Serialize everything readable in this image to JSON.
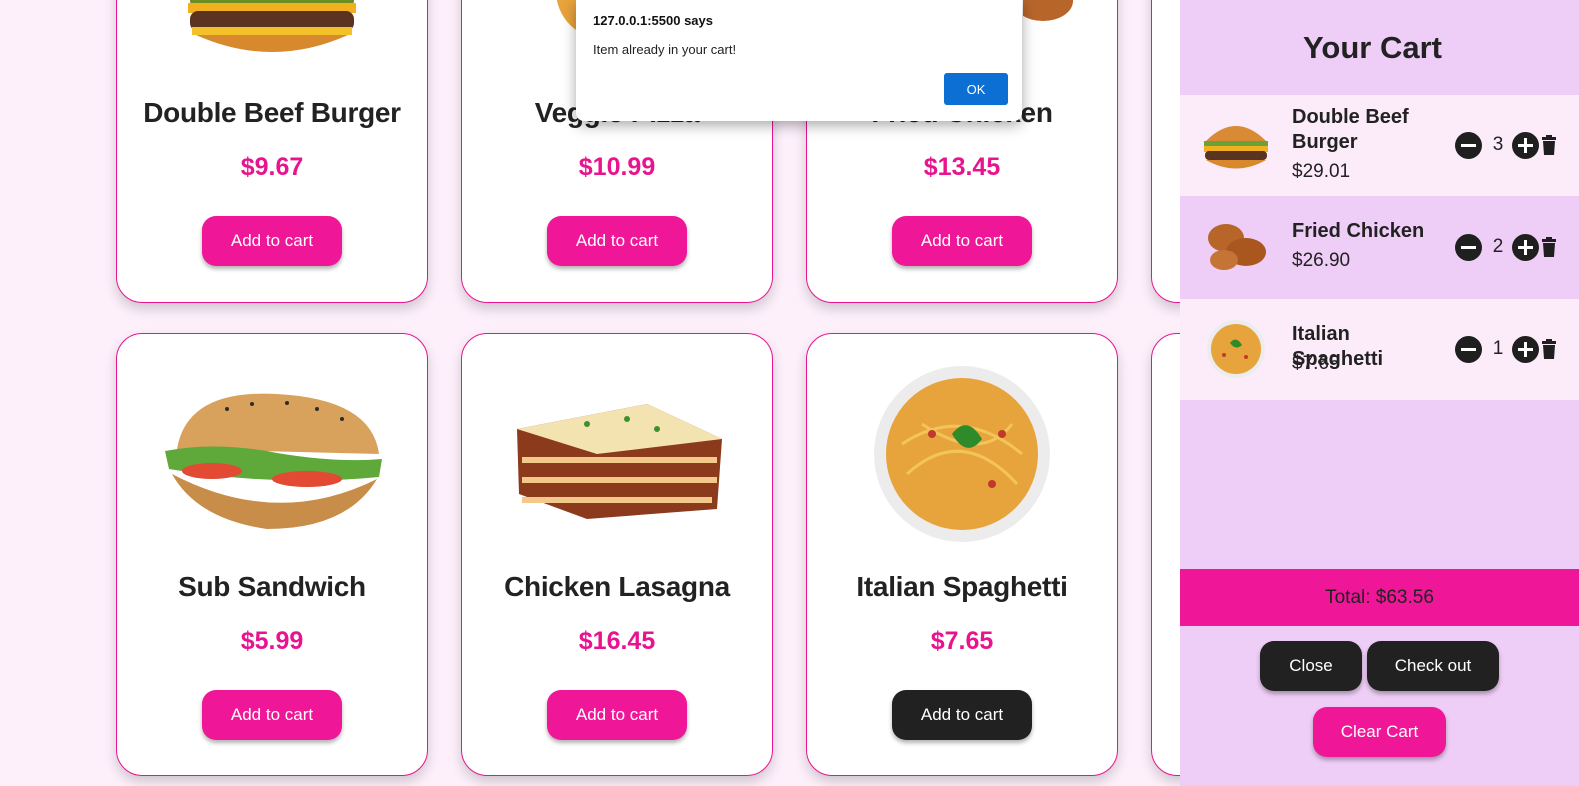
{
  "products": [
    {
      "name": "Double Beef Burger",
      "price": "$9.67",
      "button": "Add to cart"
    },
    {
      "name": "Veggie Pizza",
      "price": "$10.99",
      "button": "Add to cart"
    },
    {
      "name": "Fried Chicken",
      "price": "$13.45",
      "button": "Add to cart"
    },
    {
      "name": "Sub Sandwich",
      "price": "$5.99",
      "button": "Add to cart"
    },
    {
      "name": "Chicken Lasagna",
      "price": "$16.45",
      "button": "Add to cart"
    },
    {
      "name": "Italian Spaghetti",
      "price": "$7.65",
      "button": "Add to cart"
    }
  ],
  "cart": {
    "title": "Your Cart",
    "items": [
      {
        "name": "Double Beef Burger",
        "price": "$29.01",
        "qty": "3"
      },
      {
        "name": "Fried Chicken",
        "price": "$26.90",
        "qty": "2"
      },
      {
        "name": "Italian Spaghetti",
        "price": "$7.65",
        "qty": "1"
      }
    ],
    "total": "Total: $63.56",
    "close_label": "Close",
    "checkout_label": "Check out",
    "clear_label": "Clear Cart"
  },
  "alert": {
    "title": "127.0.0.1:5500 says",
    "message": "Item already in your cart!",
    "ok_label": "OK"
  },
  "colors": {
    "accent": "#ef1697",
    "dark_button": "#212121",
    "cart_panel": "#eecdf6",
    "alert_ok": "#0b6fd4"
  }
}
